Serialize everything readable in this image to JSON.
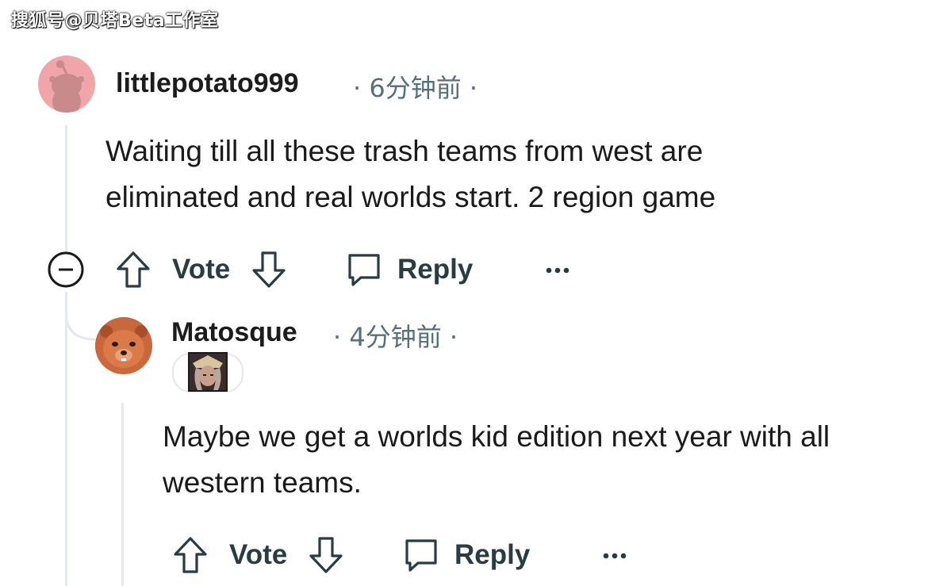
{
  "watermark": "搜狐号@贝塔Beta工作室",
  "comment1": {
    "username": "littlepotato999",
    "time": "6分钟前",
    "body": "Waiting till all these trash teams from west are eliminated and real worlds start. 2 region game",
    "actions": {
      "vote": "Vote",
      "reply": "Reply"
    }
  },
  "comment2": {
    "username": "Matosque",
    "time": "4分钟前",
    "body": "Maybe we get a worlds kid edition next year with all western teams.",
    "actions": {
      "vote": "Vote",
      "reply": "Reply"
    }
  },
  "colors": {
    "meta": "#576f76",
    "thread": "#e6e9ec",
    "avatar1_bg": "#f0a5a8",
    "avatar2_bg": "#c5663a"
  }
}
